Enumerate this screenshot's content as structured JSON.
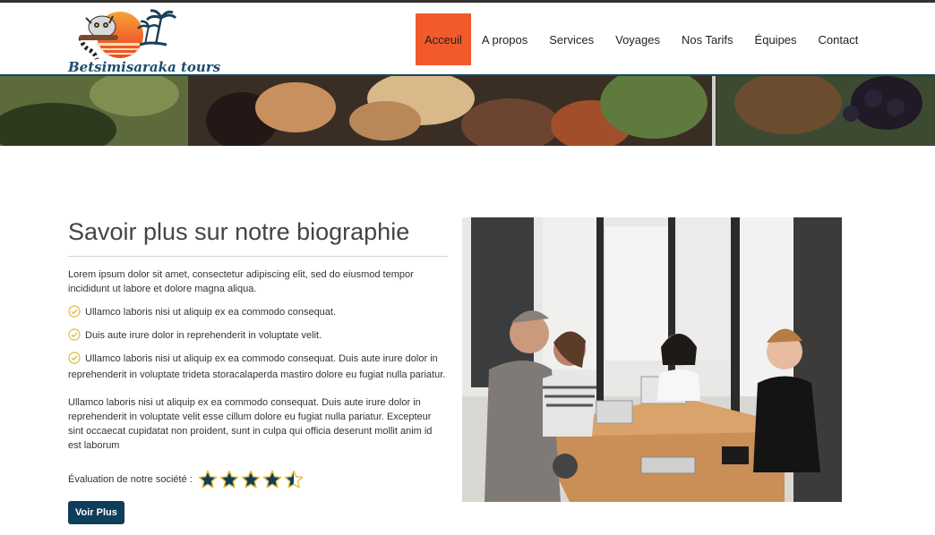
{
  "brand": {
    "name": "Betsimisaraka tours"
  },
  "nav": {
    "items": [
      {
        "label": "Acceuil",
        "active": true
      },
      {
        "label": "A propos"
      },
      {
        "label": "Services"
      },
      {
        "label": "Voyages"
      },
      {
        "label": "Nos Tarifs"
      },
      {
        "label": "Équipes"
      },
      {
        "label": "Contact"
      }
    ]
  },
  "about": {
    "title": "Savoir plus sur notre biographie",
    "intro": "Lorem ipsum dolor sit amet, consectetur adipiscing elit, sed do eiusmod tempor incididunt ut labore et dolore magna aliqua.",
    "checklist": [
      "Ullamco laboris nisi ut aliquip ex ea commodo consequat.",
      "Duis aute irure dolor in reprehenderit in voluptate velit.",
      "Ullamco laboris nisi ut aliquip ex ea commodo consequat. Duis aute irure dolor in reprehenderit in voluptate trideta storacalaperda mastiro dolore eu fugiat nulla pariatur."
    ],
    "paragraph": "Ullamco laboris nisi ut aliquip ex ea commodo consequat. Duis aute irure dolor in reprehenderit in voluptate velit esse cillum dolore eu fugiat nulla pariatur. Excepteur sint occaecat cupidatat non proident, sunt in culpa qui officia deserunt mollit anim id est laborum",
    "rating_label": "Évaluation de notre société :",
    "rating_value": 4.5,
    "rating_max": 5,
    "button_label": "Voir Plus"
  },
  "colors": {
    "accent": "#f15a2b",
    "primary": "#0f3e5a",
    "star_fill": "#0f3e5a",
    "star_outline": "#e8c14a",
    "check": "#e0b93a"
  }
}
